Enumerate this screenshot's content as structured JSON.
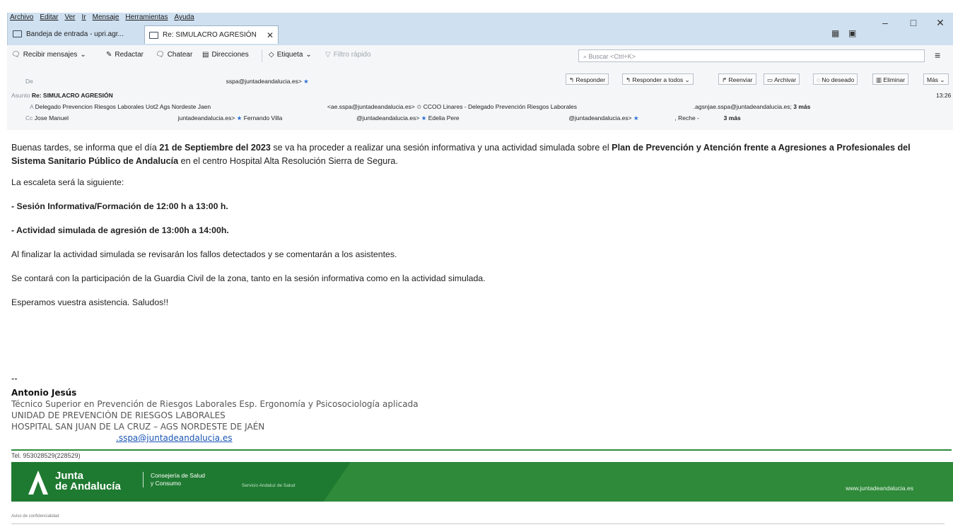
{
  "menu": [
    "Archivo",
    "Editar",
    "Ver",
    "Ir",
    "Mensaje",
    "Herramientas",
    "Ayuda"
  ],
  "window_controls": {
    "minimize": "–",
    "maximize": "□",
    "close": "✕"
  },
  "tabs": [
    {
      "label": "Bandeja de entrada - upri.agr..."
    },
    {
      "label": "Re: SIMULACRO AGRESIÓN",
      "close": "✕"
    }
  ],
  "toolbar": {
    "get_messages": "Recibir mensajes",
    "compose": "Redactar",
    "chat": "Chatear",
    "address_book": "Direcciones",
    "tag": "Etiqueta",
    "quick_filter": "Filtro rápido",
    "search_placeholder": "Buscar <Ctrl+K>",
    "menu_icon": "≡"
  },
  "header": {
    "from_label": "De",
    "from_value": "sspa@juntadeandalucia.es>",
    "subject_label": "Asunto",
    "subject_value": "Re: SIMULACRO AGRESIÓN",
    "time": "13:26",
    "to_label": "A",
    "to_value_1": "Delegado Prevencion Riesgos Laborales Uot2 Ags Nordeste Jaen",
    "to_value_2": "<ae.sspa@juntadeandalucia.es>",
    "to_value_3": "CCOO Linares - Delegado Prevención Riesgos Laborales",
    "to_value_4": ".agsnjae.sspa@juntadeandalucia.es;",
    "to_more": "3 más",
    "cc_label": "Cc",
    "cc_value_1": "Jose Manuel",
    "cc_value_2": "juntadeandalucia.es>",
    "cc_value_3": "Fernando Villa",
    "cc_value_4": "@juntadeandalucia.es>",
    "cc_value_5": "Edelia Pere",
    "cc_value_6": "@juntadeandalucia.es>",
    "cc_value_7": ", Reche -",
    "cc_more": "3 más",
    "buttons": {
      "reply": "Responder",
      "reply_all": "Responder a todos",
      "forward": "Reenviar",
      "archive": "Archivar",
      "junk": "No deseado",
      "delete": "Eliminar",
      "more": "Más"
    }
  },
  "body": {
    "p1_a": "Buenas tardes, se informa que el día ",
    "p1_date": "21 de Septiembre del 2023",
    "p1_b": " se va ha proceder a realizar una sesión informativa y una actividad simulada sobre el ",
    "p1_plan": "Plan de Prevención y Atención frente a Agresiones a Profesionales del Sistema Sanitario Público de Andalucía",
    "p1_c": " en el centro Hospital Alta Resolución Sierra de Segura.",
    "p2": "La escaleta será la siguiente:",
    "p3": "- Sesión Informativa/Formación de 12:00 h a 13:00 h.",
    "p4": "- Actividad simulada de agresión de 13:00h a 14:00h.",
    "p5": "Al finalizar la actividad simulada se revisarán los fallos detectados y se comentarán a los asistentes.",
    "p6": "Se contará con la participación de la Guardia Civil de la zona, tanto en la sesión informativa como en la actividad simulada.",
    "p7": "Esperamos vuestra asistencia. Saludos!!"
  },
  "signature": {
    "dashes": "--",
    "name": "Antonio Jesús",
    "line1": "Técnico Superior en Prevención de Riesgos Laborales Esp. Ergonomía y Psicosociología aplicada",
    "line2": "UNIDAD DE PREVENCIÓN DE RIESGOS LABORALES",
    "line3": "HOSPITAL SAN JUAN DE LA CRUZ – AGS NORDESTE DE JAÉN",
    "email": ".sspa@juntadeandalucia.es",
    "tel": "Tel. 953028529(228529)"
  },
  "banner": {
    "junta_line1": "Junta",
    "junta_line2": "de Andalucía",
    "consejeria_line1": "Consejería de Salud",
    "consejeria_line2": "y Consumo",
    "sas": "Servicio Andaluz de Salud",
    "web": "www.juntadeandalucia.es",
    "bg": "#2f8a3a"
  },
  "confidential_title": "Aviso de confidencialidad"
}
